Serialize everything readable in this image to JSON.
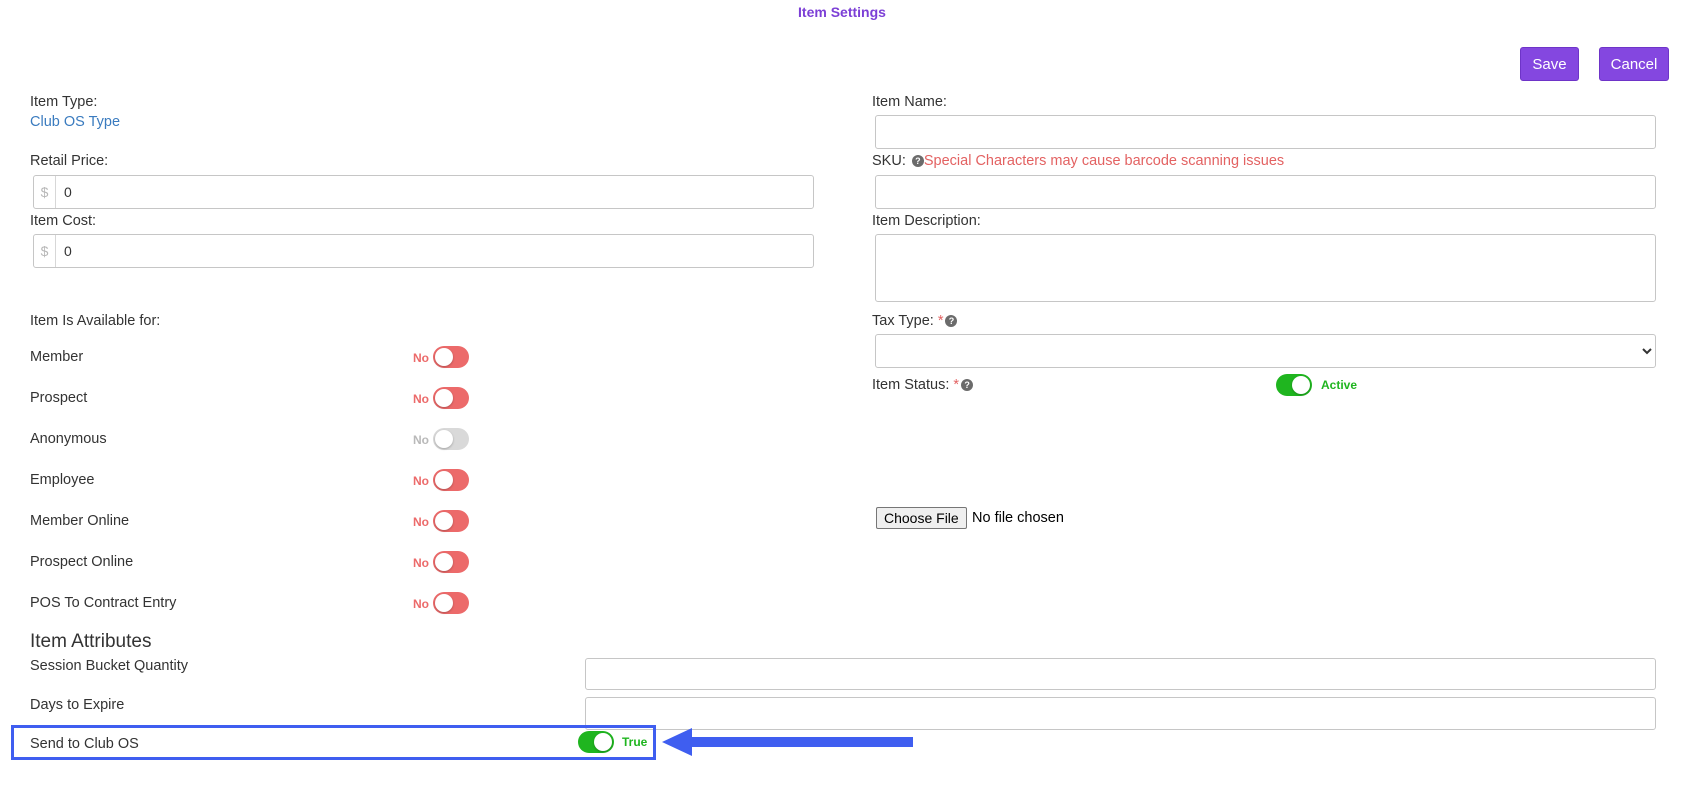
{
  "header": {
    "title": "Item Settings"
  },
  "toolbar": {
    "save_label": "Save",
    "cancel_label": "Cancel"
  },
  "left": {
    "item_type_label": "Item Type:",
    "item_type_value": "Club OS Type",
    "retail_price_label": "Retail Price:",
    "retail_price_value": "0",
    "item_cost_label": "Item Cost:",
    "item_cost_value": "0",
    "currency_symbol": "$",
    "availability_label": "Item Is Available for:",
    "availability": [
      {
        "label": "Member",
        "state": "No",
        "on": false,
        "disabled": false
      },
      {
        "label": "Prospect",
        "state": "No",
        "on": false,
        "disabled": false
      },
      {
        "label": "Anonymous",
        "state": "No",
        "on": false,
        "disabled": true
      },
      {
        "label": "Employee",
        "state": "No",
        "on": false,
        "disabled": false
      },
      {
        "label": "Member Online",
        "state": "No",
        "on": false,
        "disabled": false
      },
      {
        "label": "Prospect Online",
        "state": "No",
        "on": false,
        "disabled": false
      },
      {
        "label": "POS To Contract Entry",
        "state": "No",
        "on": false,
        "disabled": false
      }
    ]
  },
  "right": {
    "item_name_label": "Item Name:",
    "item_name_value": "",
    "sku_label": "SKU:",
    "sku_warning": "Special Characters may cause barcode scanning issues",
    "sku_value": "",
    "description_label": "Item Description:",
    "description_value": "",
    "tax_type_label": "Tax Type:",
    "required_mark": "*",
    "tax_type_selected": "",
    "item_status_label": "Item Status:",
    "item_status_state": "Active",
    "file_button_label": "Choose File",
    "file_status": "No file chosen"
  },
  "attributes": {
    "title": "Item Attributes",
    "session_bucket_label": "Session Bucket Quantity",
    "session_bucket_value": "",
    "days_to_expire_label": "Days to Expire",
    "days_to_expire_value": "",
    "send_to_club_label": "Send to Club OS",
    "send_to_club_state": "True"
  },
  "icons": {
    "help": "question-circle-icon",
    "arrow": "arrow-left-icon",
    "dropdown": "chevron-down-icon"
  },
  "colors": {
    "accent": "#8447e0",
    "toggle_off": "#ec6a6a",
    "toggle_on": "#1fb51f",
    "toggle_disabled": "#d9d9d9",
    "link": "#3a7bbf",
    "warning": "#e36262",
    "highlight": "#3f5ef0"
  }
}
